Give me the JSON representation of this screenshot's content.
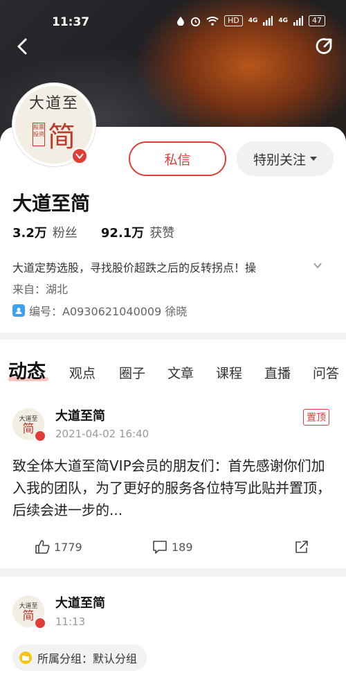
{
  "status_bar": {
    "time": "11:37",
    "hd_label": "HD",
    "signal1": "4G",
    "signal2": "4G",
    "battery": "47"
  },
  "profile": {
    "avatar_text_top": "大道至",
    "avatar_seal": "股票投资",
    "avatar_text_big": "简",
    "name": "大道至简",
    "message_button": "私信",
    "follow_button": "特别关注",
    "fans_count": "3.2万",
    "fans_label": "粉丝",
    "likes_count": "92.1万",
    "likes_label": "获赞",
    "bio": "大道定势选股，寻找股价超跌之后的反转拐点！操",
    "from": "来自：湖北",
    "id_line": "编号：A0930621040009  徐晓"
  },
  "tabs": [
    {
      "label": "动态",
      "active": true
    },
    {
      "label": "观点",
      "active": false
    },
    {
      "label": "圈子",
      "active": false
    },
    {
      "label": "文章",
      "active": false
    },
    {
      "label": "课程",
      "active": false
    },
    {
      "label": "直播",
      "active": false
    },
    {
      "label": "问答",
      "active": false
    }
  ],
  "posts": [
    {
      "author": "大道至简",
      "time": "2021-04-02 16:40",
      "tag": "置顶",
      "text": "致全体大道至简VIP会员的朋友们：首先感谢你们加入我的团队，为了更好的服务各位特写此贴并置顶，后续会进一步的...",
      "likes": "1779",
      "comments": "189"
    },
    {
      "author": "大道至简",
      "time": "11:13",
      "group": "所属分组：默认分组"
    }
  ],
  "colors": {
    "accent": "#e23c36",
    "text": "#222222",
    "muted": "#999999"
  }
}
